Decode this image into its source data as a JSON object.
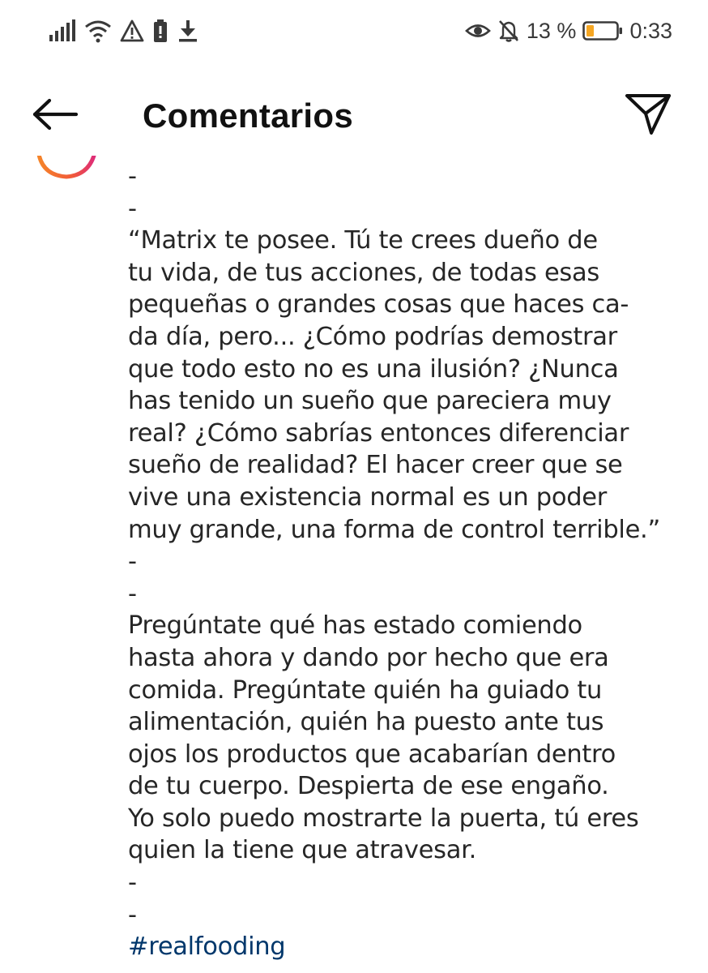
{
  "status_bar": {
    "battery_percent": "13 %",
    "time": "0:33",
    "icons": [
      "signal-icon",
      "wifi-icon",
      "warning-icon",
      "battery-saver-icon",
      "download-icon",
      "eye-icon",
      "notifications-off-icon",
      "battery-icon"
    ]
  },
  "header": {
    "title": "Comentarios",
    "back_icon": "arrow-left-icon",
    "share_icon": "send-icon"
  },
  "comment": {
    "lines": [
      "-",
      "-",
      "“Matrix te posee. Tú te crees dueño de",
      "tu vida, de tus acciones, de todas esas",
      "pequeñas o grandes cosas que haces ca-",
      "da día, pero... ¿Cómo podrías demostrar",
      "que todo esto no es una ilusión? ¿Nunca",
      "has tenido un sueño que pareciera muy",
      "real? ¿Cómo sabrías entonces diferenciar",
      "sueño de realidad? El hacer creer que se",
      "vive una existencia normal es un poder",
      "muy grande, una forma de control terrible.”",
      "-",
      "-",
      "Pregúntate qué has estado comiendo",
      "hasta ahora y dando por hecho que era",
      "comida. Pregúntate quién ha guiado tu",
      "alimentación, quién ha puesto ante tus",
      "ojos los productos que acabarían dentro",
      "de tu cuerpo. Despierta de ese engaño.",
      "Yo solo puedo mostrarte la puerta, tú eres",
      "quien la tiene que atravesar.",
      "-",
      "-"
    ],
    "hashtag": "#realfooding"
  },
  "colors": {
    "text": "#262626",
    "hashtag": "#00376b",
    "battery_low": "#f5a623",
    "avatar_ring_start": "#f58529",
    "avatar_ring_end": "#dd2a7b"
  }
}
